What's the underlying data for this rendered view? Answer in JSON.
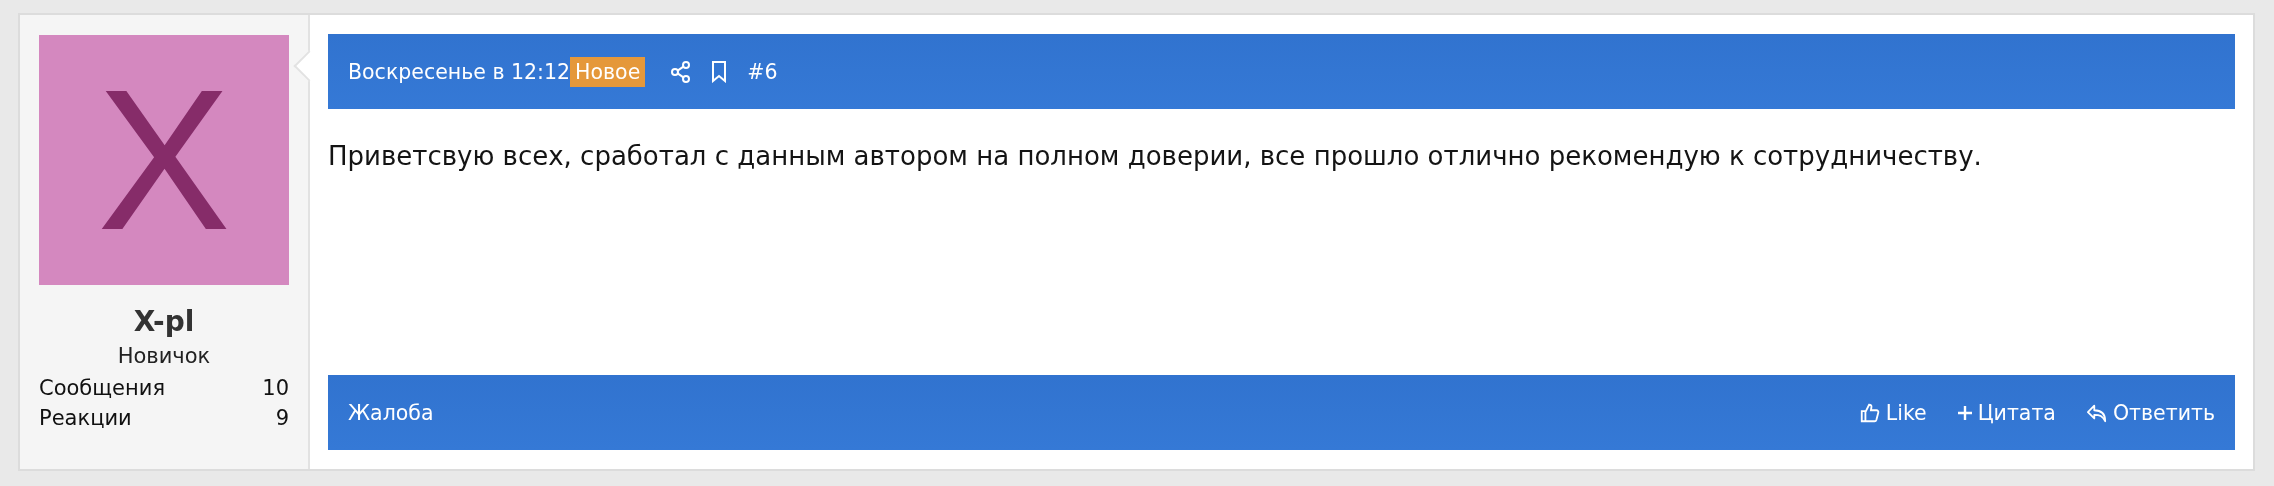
{
  "author": {
    "avatar_letter": "X",
    "name": "X-pl",
    "title": "Новичок",
    "stats": [
      {
        "label": "Сообщения",
        "value": "10"
      },
      {
        "label": "Реакции",
        "value": "9"
      }
    ]
  },
  "header": {
    "date": "Воскресенье в 12:12",
    "badge": "Новое",
    "post_number": "#6"
  },
  "body": "Приветсвую всех, сработал с данным автором на полном доверии, все прошло отлично рекомендую к сотрудничеству.",
  "footer": {
    "report": "Жалоба",
    "actions": [
      {
        "kind": "like",
        "label": "Like"
      },
      {
        "kind": "quote",
        "label": "Цитата"
      },
      {
        "kind": "reply",
        "label": "Ответить"
      }
    ]
  }
}
